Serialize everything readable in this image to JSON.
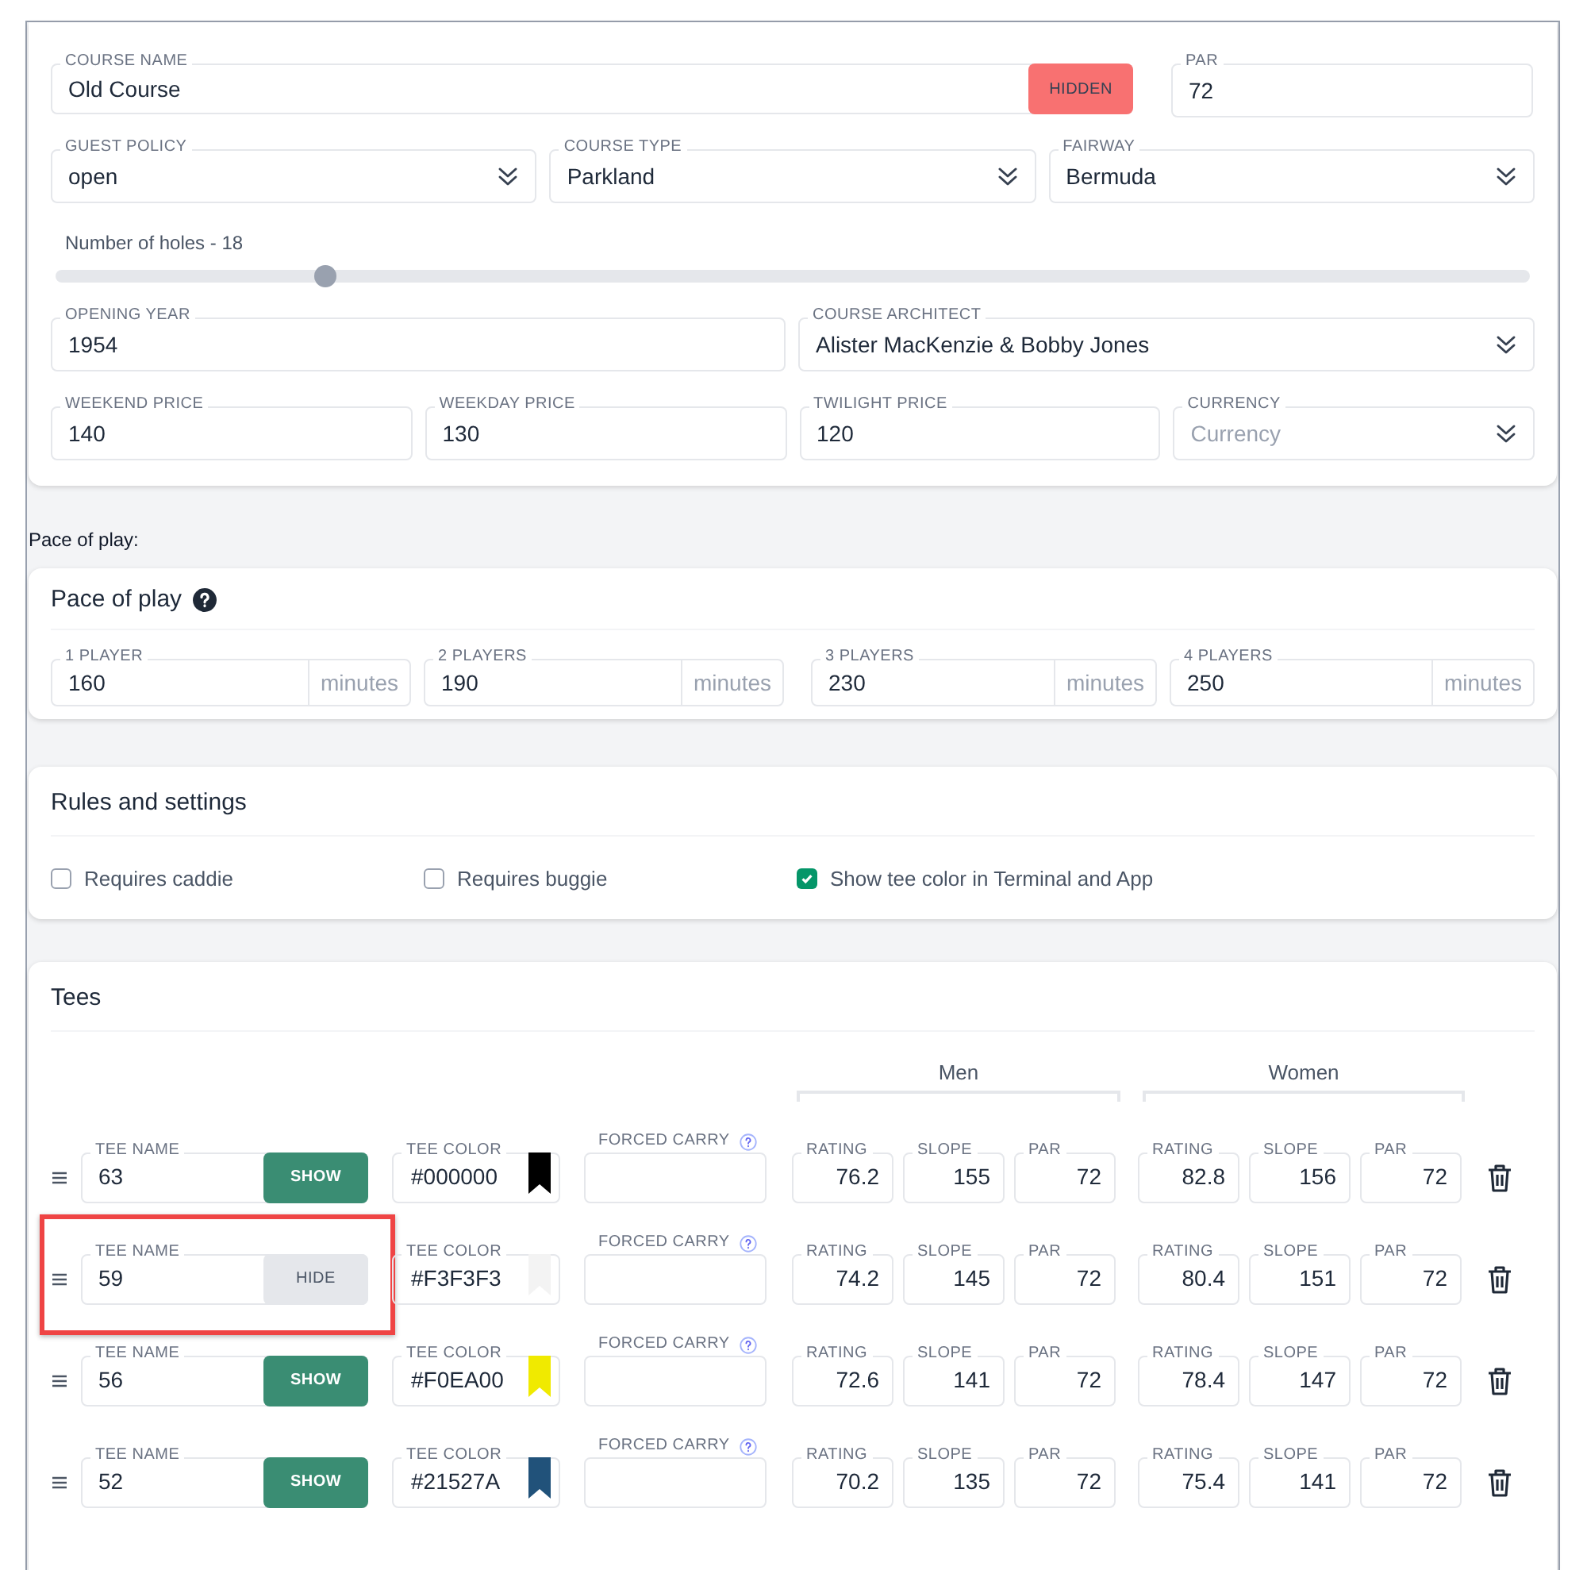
{
  "course_name": {
    "label": "COURSE NAME",
    "value": "Old Course",
    "visibility": {
      "label": "HIDDEN",
      "active": true
    }
  },
  "par": {
    "label": "PAR",
    "value": "72"
  },
  "selects": [
    {
      "label": "GUEST POLICY",
      "value": "open"
    },
    {
      "label": "COURSE TYPE",
      "value": "Parkland"
    },
    {
      "label": "FAIRWAY",
      "value": "Bermuda"
    }
  ],
  "holes": {
    "label": "Number of holes - 18",
    "level": 0.183
  },
  "opening_year": {
    "label": "OPENING YEAR",
    "value": "1954"
  },
  "course_architect": {
    "label": "COURSE ARCHITECT",
    "value": "Alister MacKenzie & Bobby Jones"
  },
  "prices": [
    {
      "kind": "text",
      "label": "WEEKEND PRICE",
      "value": "140"
    },
    {
      "kind": "text",
      "label": "WEEKDAY PRICE",
      "value": "130"
    },
    {
      "kind": "text",
      "label": "TWILIGHT PRICE",
      "value": "120"
    },
    {
      "kind": "select",
      "label": "CURRENCY",
      "placeholder": "Currency"
    }
  ],
  "pace_section_label": "Pace of play:",
  "pace": {
    "title": "Pace of play",
    "fields": [
      {
        "label": "1 PLAYER",
        "value": "160",
        "unit": "minutes"
      },
      {
        "label": "2 PLAYERS",
        "value": "190",
        "unit": "minutes"
      },
      {
        "label": "3 PLAYERS",
        "value": "230",
        "unit": "minutes"
      },
      {
        "label": "4 PLAYERS",
        "value": "250",
        "unit": "minutes"
      }
    ]
  },
  "rules": {
    "title": "Rules and settings",
    "options": [
      {
        "label": "Requires caddie",
        "checked": false
      },
      {
        "label": "Requires buggie",
        "checked": false
      },
      {
        "label": "Show tee color in Terminal and App",
        "checked": true
      }
    ]
  },
  "tees": {
    "title": "Tees",
    "groups": [
      "Men",
      "Women"
    ],
    "rows": [
      {
        "highlighted": false,
        "name_label": "TEE NAME",
        "name": "63",
        "toggle": {
          "label": "SHOW",
          "active": true
        },
        "color_label": "TEE COLOR",
        "color_value": "#000000",
        "color": "#000000",
        "forced_carry_label": "FORCED CARRY",
        "men": [
          {
            "label": "RATING",
            "value": "76.2"
          },
          {
            "label": "SLOPE",
            "value": "155"
          },
          {
            "label": "PAR",
            "value": "72"
          }
        ],
        "women": [
          {
            "label": "RATING",
            "value": "82.8"
          },
          {
            "label": "SLOPE",
            "value": "156"
          },
          {
            "label": "PAR",
            "value": "72"
          }
        ]
      },
      {
        "highlighted": true,
        "name_label": "TEE NAME",
        "name": "59",
        "toggle": {
          "label": "HIDE",
          "active": false
        },
        "color_label": "TEE COLOR",
        "color_value": "#F3F3F3",
        "color": "#f3f3f3",
        "forced_carry_label": "FORCED CARRY",
        "men": [
          {
            "label": "RATING",
            "value": "74.2"
          },
          {
            "label": "SLOPE",
            "value": "145"
          },
          {
            "label": "PAR",
            "value": "72"
          }
        ],
        "women": [
          {
            "label": "RATING",
            "value": "80.4"
          },
          {
            "label": "SLOPE",
            "value": "151"
          },
          {
            "label": "PAR",
            "value": "72"
          }
        ]
      },
      {
        "highlighted": false,
        "name_label": "TEE NAME",
        "name": "56",
        "toggle": {
          "label": "SHOW",
          "active": true
        },
        "color_label": "TEE COLOR",
        "color_value": "#F0EA00",
        "color": "#f0ea00",
        "forced_carry_label": "FORCED CARRY",
        "men": [
          {
            "label": "RATING",
            "value": "72.6"
          },
          {
            "label": "SLOPE",
            "value": "141"
          },
          {
            "label": "PAR",
            "value": "72"
          }
        ],
        "women": [
          {
            "label": "RATING",
            "value": "78.4"
          },
          {
            "label": "SLOPE",
            "value": "147"
          },
          {
            "label": "PAR",
            "value": "72"
          }
        ]
      },
      {
        "highlighted": false,
        "name_label": "TEE NAME",
        "name": "52",
        "toggle": {
          "label": "SHOW",
          "active": true
        },
        "color_label": "TEE COLOR",
        "color_value": "#21527A",
        "color": "#21527a",
        "forced_carry_label": "FORCED CARRY",
        "men": [
          {
            "label": "RATING",
            "value": "70.2"
          },
          {
            "label": "SLOPE",
            "value": "135"
          },
          {
            "label": "PAR",
            "value": "72"
          }
        ],
        "women": [
          {
            "label": "RATING",
            "value": "75.4"
          },
          {
            "label": "SLOPE",
            "value": "141"
          },
          {
            "label": "PAR",
            "value": "72"
          }
        ]
      }
    ]
  }
}
